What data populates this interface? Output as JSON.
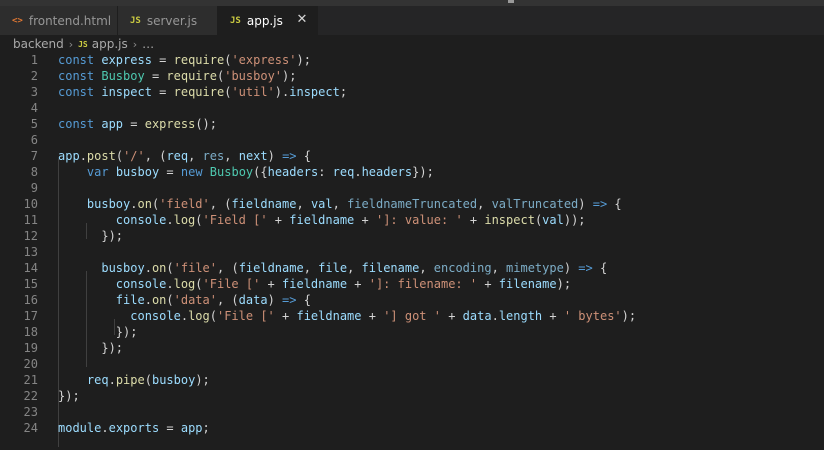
{
  "tabs": [
    {
      "label": "frontend.html",
      "icon": "html-file-icon",
      "icon_glyph": "<>"
    },
    {
      "label": "server.js",
      "icon": "js-file-icon",
      "icon_glyph": "JS"
    },
    {
      "label": "app.js",
      "icon": "js-file-icon",
      "icon_glyph": "JS",
      "active": true
    }
  ],
  "tab_close_glyph": "✕",
  "breadcrumb": {
    "folder": "backend",
    "file_icon": "JS",
    "file": "app.js",
    "tail": "…",
    "separator": "›"
  },
  "lines": [
    "1",
    "2",
    "3",
    "4",
    "5",
    "6",
    "7",
    "8",
    "9",
    "10",
    "11",
    "12",
    "13",
    "14",
    "15",
    "16",
    "17",
    "18",
    "19",
    "20",
    "21",
    "22",
    "23",
    "24"
  ],
  "code": [
    "const express = require('express');",
    "const Busboy = require('busboy');",
    "const inspect = require('util').inspect;",
    "",
    "const app = express();",
    "",
    "app.post('/', (req, res, next) => {",
    "    var busboy = new Busboy({headers: req.headers});",
    "",
    "    busboy.on('field', (fieldname, val, fieldnameTruncated, valTruncated) => {",
    "        console.log('Field [' + fieldname + ']: value: ' + inspect(val));",
    "      });",
    "",
    "      busboy.on('file', (fieldname, file, filename, encoding, mimetype) => {",
    "        console.log('File [' + fieldname + ']: filename: ' + filename);",
    "        file.on('data', (data) => {",
    "          console.log('File [' + fieldname + '] got ' + data.length + ' bytes');",
    "        });",
    "      });",
    "",
    "    req.pipe(busboy);",
    "});",
    "",
    "module.exports = app;"
  ],
  "colors": {
    "keyword": "#569cd6",
    "variable": "#9cdcfe",
    "function": "#dcdcaa",
    "string": "#ce9178",
    "class": "#4ec9b0",
    "background": "#1e1e1e"
  }
}
